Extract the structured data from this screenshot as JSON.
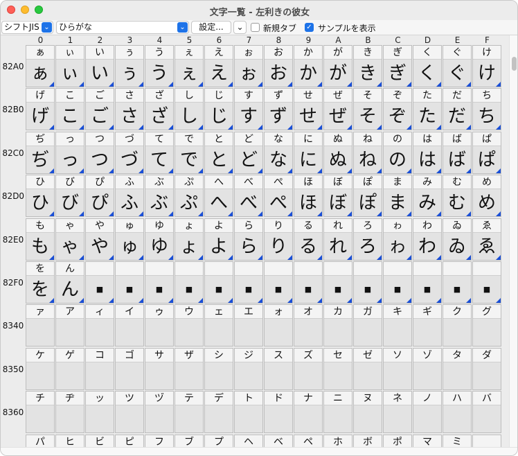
{
  "window": {
    "title": "文字一覧 - 左利きの彼女"
  },
  "toolbar": {
    "encoding_value": "シフトJIS",
    "block_value": "ひらがな",
    "settings_label": "設定...",
    "new_tab_label": "新規タブ",
    "new_tab_checked": false,
    "show_sample_label": "サンプルを表示",
    "show_sample_checked": true
  },
  "grid": {
    "columns": [
      "0",
      "1",
      "2",
      "3",
      "4",
      "5",
      "6",
      "7",
      "8",
      "9",
      "A",
      "B",
      "C",
      "D",
      "E",
      "F"
    ],
    "rows": [
      {
        "code": "82A0",
        "chars": [
          "ぁ",
          "ぃ",
          "い",
          "ぅ",
          "う",
          "ぇ",
          "え",
          "ぉ",
          "お",
          "か",
          "が",
          "き",
          "ぎ",
          "く",
          "ぐ",
          "け"
        ]
      },
      {
        "code": "82B0",
        "chars": [
          "げ",
          "こ",
          "ご",
          "さ",
          "ざ",
          "し",
          "じ",
          "す",
          "ず",
          "せ",
          "ぜ",
          "そ",
          "ぞ",
          "た",
          "だ",
          "ち"
        ]
      },
      {
        "code": "82C0",
        "chars": [
          "ぢ",
          "っ",
          "つ",
          "づ",
          "て",
          "で",
          "と",
          "ど",
          "な",
          "に",
          "ぬ",
          "ね",
          "の",
          "は",
          "ば",
          "ぱ"
        ]
      },
      {
        "code": "82D0",
        "chars": [
          "ひ",
          "び",
          "ぴ",
          "ふ",
          "ぶ",
          "ぷ",
          "へ",
          "べ",
          "ぺ",
          "ほ",
          "ぼ",
          "ぽ",
          "ま",
          "み",
          "む",
          "め"
        ]
      },
      {
        "code": "82E0",
        "chars": [
          "も",
          "ゃ",
          "や",
          "ゅ",
          "ゆ",
          "ょ",
          "よ",
          "ら",
          "り",
          "る",
          "れ",
          "ろ",
          "ゎ",
          "わ",
          "ゐ",
          "ゑ"
        ]
      },
      {
        "code": "82F0",
        "chars": [
          "を",
          "ん",
          "",
          "",
          "",
          "",
          "",
          "",
          "",
          "",
          "",
          "",
          "",
          "",
          "",
          ""
        ]
      },
      {
        "code": "8340",
        "chars": [
          "ァ",
          "ア",
          "ィ",
          "イ",
          "ゥ",
          "ウ",
          "ェ",
          "エ",
          "ォ",
          "オ",
          "カ",
          "ガ",
          "キ",
          "ギ",
          "ク",
          "グ"
        ]
      },
      {
        "code": "8350",
        "chars": [
          "ケ",
          "ゲ",
          "コ",
          "ゴ",
          "サ",
          "ザ",
          "シ",
          "ジ",
          "ス",
          "ズ",
          "セ",
          "ゼ",
          "ソ",
          "ゾ",
          "タ",
          "ダ"
        ]
      },
      {
        "code": "8360",
        "chars": [
          "チ",
          "ヂ",
          "ッ",
          "ツ",
          "ヅ",
          "テ",
          "デ",
          "ト",
          "ド",
          "ナ",
          "ニ",
          "ヌ",
          "ネ",
          "ノ",
          "ハ",
          "バ"
        ]
      },
      {
        "code": "",
        "chars": [
          "パ",
          "ヒ",
          "ビ",
          "ピ",
          "フ",
          "ブ",
          "プ",
          "ヘ",
          "ベ",
          "ペ",
          "ホ",
          "ボ",
          "ポ",
          "マ",
          "ミ",
          ""
        ]
      }
    ],
    "sample_rows": 6,
    "placeholder_glyph": "■"
  }
}
